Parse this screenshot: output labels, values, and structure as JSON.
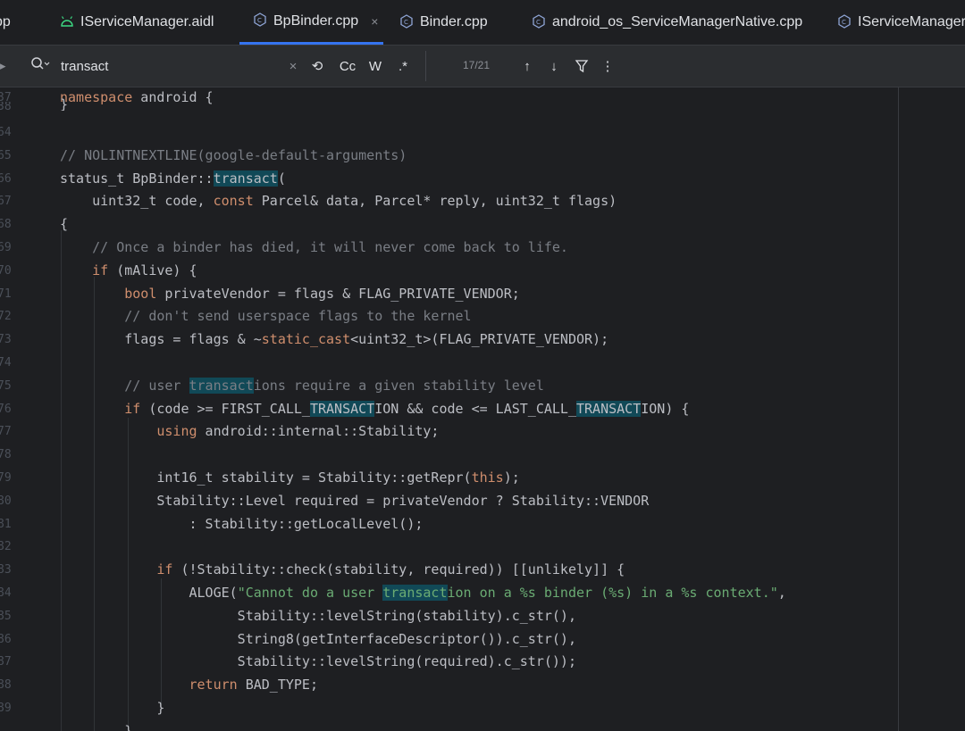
{
  "tabs": [
    {
      "label": "pp",
      "icon": "none"
    },
    {
      "label": "IServiceManager.aidl",
      "icon": "android-icon"
    },
    {
      "label": "BpBinder.cpp",
      "icon": "cpp-file-icon",
      "active": true,
      "close": "×"
    },
    {
      "label": "Binder.cpp",
      "icon": "cpp-file-icon"
    },
    {
      "label": "android_os_ServiceManagerNative.cpp",
      "icon": "cpp-file-icon"
    },
    {
      "label": "IServiceManager.c",
      "icon": "cpp-file-icon"
    }
  ],
  "search": {
    "query": "transact",
    "clear": "×",
    "history": "⟲",
    "match_case": "Cc",
    "whole_words": "W",
    "regex": ".*",
    "count": "17/21",
    "prev": "↑",
    "next": "↓",
    "filter": "⊽",
    "more": "⋮"
  },
  "line_numbers": [
    "37",
    "38",
    "64",
    "65",
    "66",
    "67",
    "68",
    "69",
    "70",
    "71",
    "72",
    "73",
    "74",
    "75",
    "76",
    "77",
    "78",
    "79",
    "80",
    "81",
    "82",
    "83",
    "84",
    "85",
    "86",
    "87",
    "88",
    "89"
  ],
  "colors": {
    "background": "#1e1f22",
    "keyword": "#cf8e6d",
    "comment": "#7a7e85",
    "string": "#6aab73",
    "match": "#114957",
    "accent": "#3574f0"
  },
  "code": {
    "l0_kw": "namespace",
    "l0_rest": " android {",
    "l1": "}",
    "l2": "",
    "l3": "// NOLINTNEXTLINE(google-default-arguments)",
    "l4_a": "status_t BpBinder::",
    "l4_m": "transact",
    "l4_b": "(",
    "l5_a": "    uint32_t code, ",
    "l5_kw": "const",
    "l5_b": " Parcel& data, Parcel* reply, uint32_t flags)",
    "l6": "{",
    "l7": "    // Once a binder has died, it will never come back to life.",
    "l8_a": "    ",
    "l8_kw": "if",
    "l8_b": " (mAlive) {",
    "l9_a": "        ",
    "l9_kw": "bool",
    "l9_b": " privateVendor = flags & FLAG_PRIVATE_VENDOR;",
    "l10": "        // don't send userspace flags to the kernel",
    "l11_a": "        flags = flags & ~",
    "l11_kw": "static_cast",
    "l11_b": "<uint32_t>(FLAG_PRIVATE_VENDOR);",
    "l12": "",
    "l13_a": "        // user ",
    "l13_m": "transact",
    "l13_b": "ions require a given stability level",
    "l14_a": "        ",
    "l14_kw": "if",
    "l14_b": " (code >= FIRST_CALL_",
    "l14_m1": "TRANSACT",
    "l14_c": "ION && code <= LAST_CALL_",
    "l14_m2": "TRANSACT",
    "l14_d": "ION) {",
    "l15_a": "            ",
    "l15_kw": "using",
    "l15_b": " android::internal::Stability;",
    "l16": "",
    "l17_a": "            int16_t stability = Stability::getRepr(",
    "l17_kw": "this",
    "l17_b": ");",
    "l18": "            Stability::Level required = privateVendor ? Stability::VENDOR",
    "l19": "                : Stability::getLocalLevel();",
    "l20": "",
    "l21_a": "            ",
    "l21_kw": "if",
    "l21_b": " (!Stability::check(stability, required)) [[unlikely]] {",
    "l22_a": "                ALOGE(",
    "l22_s1": "\"Cannot do a user ",
    "l22_m": "transact",
    "l22_s2": "ion on a %s binder (%s) in a %s context.\"",
    "l22_b": ",",
    "l23": "                      Stability::levelString(stability).c_str(),",
    "l24": "                      String8(getInterfaceDescriptor()).c_str(),",
    "l25": "                      Stability::levelString(required).c_str());",
    "l26_a": "                ",
    "l26_kw": "return",
    "l26_b": " BAD_TYPE;",
    "l27": "            }",
    "l28": "        }"
  }
}
